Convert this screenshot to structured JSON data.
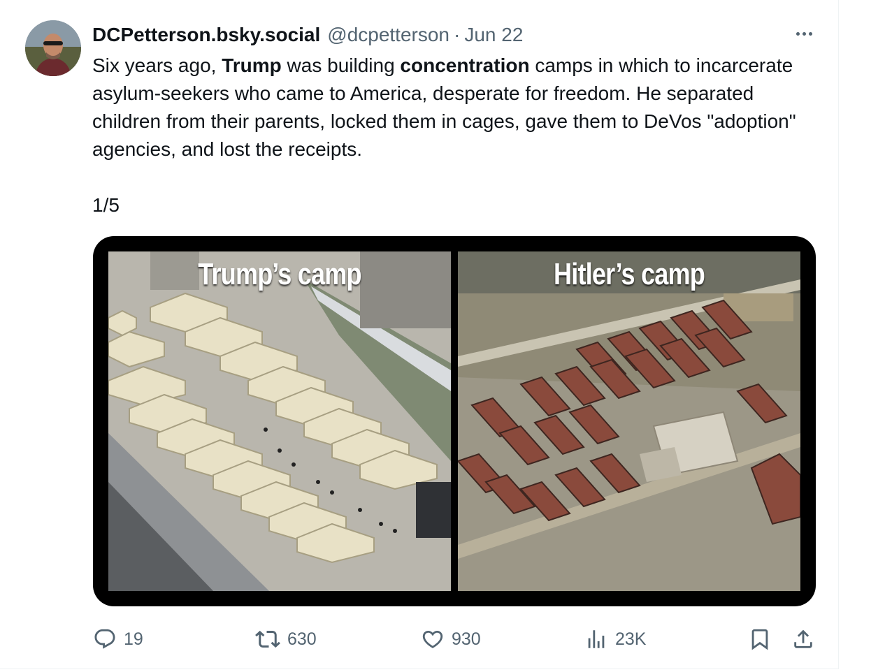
{
  "author": {
    "name": "DCPetterson.bsky.social",
    "handle": "@dcpetterson",
    "separator": "·",
    "date": "Jun 22"
  },
  "tweet": {
    "p1": "Six years ago, ",
    "b1": "Trump",
    "p2": " was building ",
    "b2": "concentration",
    "p3": " camps in which to incarcerate asylum-seekers who came to America, desperate for freedom. He separated children from their parents, locked them in cages, gave them to DeVos \"adoption\" agencies, and lost the receipts.",
    "counter": "1/5"
  },
  "media": {
    "left_caption": "Trump’s camp",
    "right_caption": "Hitler’s camp"
  },
  "actions": {
    "replies": "19",
    "reposts": "630",
    "likes": "930",
    "views": "23K"
  },
  "icons": [
    "more-icon",
    "reply-icon",
    "repost-icon",
    "like-icon",
    "views-icon",
    "bookmark-icon",
    "share-icon"
  ],
  "colors": {
    "text": "#0f1419",
    "muted": "#536471",
    "border": "#eff3f4"
  }
}
